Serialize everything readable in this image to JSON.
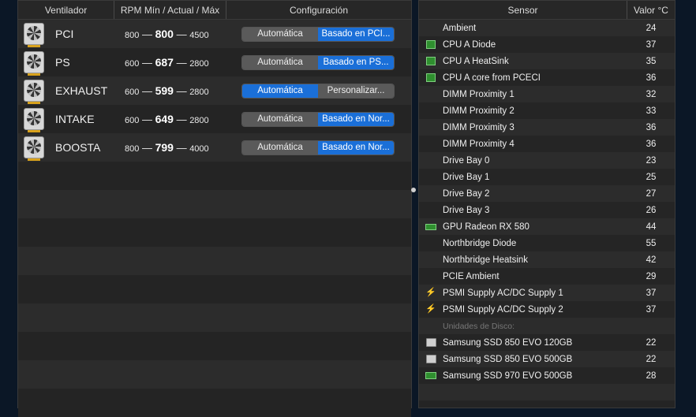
{
  "fans": {
    "headers": {
      "name": "Ventilador",
      "rpm": "RPM Mín / Actual / Máx",
      "config": "Configuración"
    },
    "rows": [
      {
        "name": "PCI",
        "min": "800",
        "current": "800",
        "max": "4500",
        "mode": "Automática",
        "preset": "Basado en PCI...",
        "mode_active": false
      },
      {
        "name": "PS",
        "min": "600",
        "current": "687",
        "max": "2800",
        "mode": "Automática",
        "preset": "Basado en PS...",
        "mode_active": false
      },
      {
        "name": "EXHAUST",
        "min": "600",
        "current": "599",
        "max": "2800",
        "mode": "Automática",
        "preset": "Personalizar...",
        "mode_active": true
      },
      {
        "name": "INTAKE",
        "min": "600",
        "current": "649",
        "max": "2800",
        "mode": "Automática",
        "preset": "Basado en Nor...",
        "mode_active": false
      },
      {
        "name": "BOOSTA",
        "min": "800",
        "current": "799",
        "max": "4000",
        "mode": "Automática",
        "preset": "Basado en Nor...",
        "mode_active": false
      }
    ]
  },
  "sensors": {
    "headers": {
      "name": "Sensor",
      "value": "Valor °C"
    },
    "rows": [
      {
        "icon": "none",
        "name": "Ambient",
        "value": "24"
      },
      {
        "icon": "chip",
        "name": "CPU A Diode",
        "value": "37"
      },
      {
        "icon": "chip",
        "name": "CPU A HeatSink",
        "value": "35"
      },
      {
        "icon": "chip",
        "name": "CPU A core from PCECI",
        "value": "36"
      },
      {
        "icon": "none",
        "name": "DIMM Proximity 1",
        "value": "32"
      },
      {
        "icon": "none",
        "name": "DIMM Proximity 2",
        "value": "33"
      },
      {
        "icon": "none",
        "name": "DIMM Proximity 3",
        "value": "36"
      },
      {
        "icon": "none",
        "name": "DIMM Proximity 4",
        "value": "36"
      },
      {
        "icon": "none",
        "name": "Drive Bay 0",
        "value": "23"
      },
      {
        "icon": "none",
        "name": "Drive Bay 1",
        "value": "25"
      },
      {
        "icon": "none",
        "name": "Drive Bay 2",
        "value": "27"
      },
      {
        "icon": "none",
        "name": "Drive Bay 3",
        "value": "26"
      },
      {
        "icon": "gpu",
        "name": "GPU Radeon RX 580",
        "value": "44"
      },
      {
        "icon": "none",
        "name": "Northbridge Diode",
        "value": "55"
      },
      {
        "icon": "none",
        "name": "Northbridge Heatsink",
        "value": "42"
      },
      {
        "icon": "none",
        "name": "PCIE Ambient",
        "value": "29"
      },
      {
        "icon": "bolt",
        "name": "PSMI Supply AC/DC Supply 1",
        "value": "37"
      },
      {
        "icon": "bolt",
        "name": "PSMI Supply AC/DC Supply 2",
        "value": "37"
      },
      {
        "icon": "none",
        "name": "Unidades de Disco:",
        "value": "",
        "section": true
      },
      {
        "icon": "disk",
        "name": "Samsung SSD 850 EVO 120GB",
        "value": "22"
      },
      {
        "icon": "disk",
        "name": "Samsung SSD 850 EVO 500GB",
        "value": "22"
      },
      {
        "icon": "nvme",
        "name": "Samsung SSD 970 EVO 500GB",
        "value": "28"
      }
    ]
  }
}
